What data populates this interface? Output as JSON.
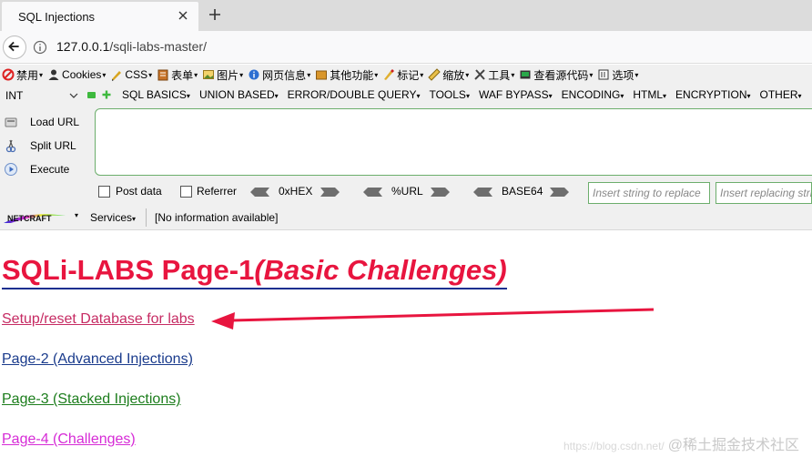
{
  "browser": {
    "tab_title": "SQL Injections",
    "url_host": "127.0.0.1",
    "url_path": "/sqli-labs-master/"
  },
  "menubar": {
    "items": [
      {
        "label": "禁用",
        "icon": "forbidden-icon"
      },
      {
        "label": "Cookies",
        "icon": "person-icon"
      },
      {
        "label": "CSS",
        "icon": "pencil-icon"
      },
      {
        "label": "表单",
        "icon": "form-icon"
      },
      {
        "label": "图片",
        "icon": "image-icon"
      },
      {
        "label": "网页信息",
        "icon": "info-icon"
      },
      {
        "label": "其他功能",
        "icon": "folder-icon"
      },
      {
        "label": "标记",
        "icon": "marker-icon"
      },
      {
        "label": "缩放",
        "icon": "ruler-icon"
      },
      {
        "label": "工具",
        "icon": "tools-icon"
      },
      {
        "label": "查看源代码",
        "icon": "source-icon"
      },
      {
        "label": "选项",
        "icon": "options-icon"
      }
    ]
  },
  "hackbar": {
    "select_value": "INT",
    "menus": [
      "SQL BASICS",
      "UNION BASED",
      "ERROR/DOUBLE QUERY",
      "TOOLS",
      "WAF BYPASS",
      "ENCODING",
      "HTML",
      "ENCRYPTION",
      "OTHER"
    ],
    "actions": {
      "load": "Load URL",
      "split": "Split URL",
      "execute": "Execute"
    },
    "post_data": "Post data",
    "referrer": "Referrer",
    "hex": "0xHEX",
    "url_enc": "%URL",
    "base64": "BASE64",
    "replace_placeholder": "Insert string to replace",
    "replacing_placeholder": "Insert replacing string"
  },
  "netcraft": {
    "services": "Services",
    "info": "[No information available]"
  },
  "page": {
    "title_main": "SQLi-LABS Page-1",
    "title_sub": "(Basic Challenges)",
    "links": {
      "setup": "Setup/reset Database for labs",
      "page2": "Page-2 (Advanced Injections)",
      "page3": "Page-3 (Stacked Injections)",
      "page4": "Page-4 (Challenges)"
    }
  },
  "watermark": {
    "site": "https://blog.csdn.net/",
    "brand": "@稀土掘金技术社区"
  },
  "colors": {
    "title": "#e8153f",
    "annotation_arrow": "#e8153f",
    "hackbar_green": "#6cae6c"
  }
}
